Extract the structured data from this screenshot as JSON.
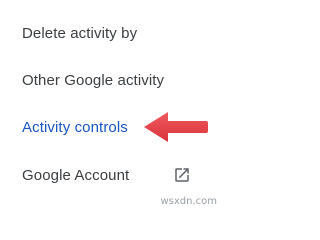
{
  "menu": {
    "items": [
      {
        "label": "Delete activity by",
        "active": false
      },
      {
        "label": "Other Google activity",
        "active": false
      },
      {
        "label": "Activity controls",
        "active": true
      },
      {
        "label": "Google Account",
        "active": false,
        "icon": "open-in-new-icon"
      }
    ]
  },
  "annotation": {
    "arrow_color": "#e8444a",
    "points_to": "Activity controls"
  },
  "colors": {
    "text": "#3c4043",
    "active_text": "#1a56c4",
    "icon": "#5f6368"
  },
  "watermark": "wsxdn.com"
}
